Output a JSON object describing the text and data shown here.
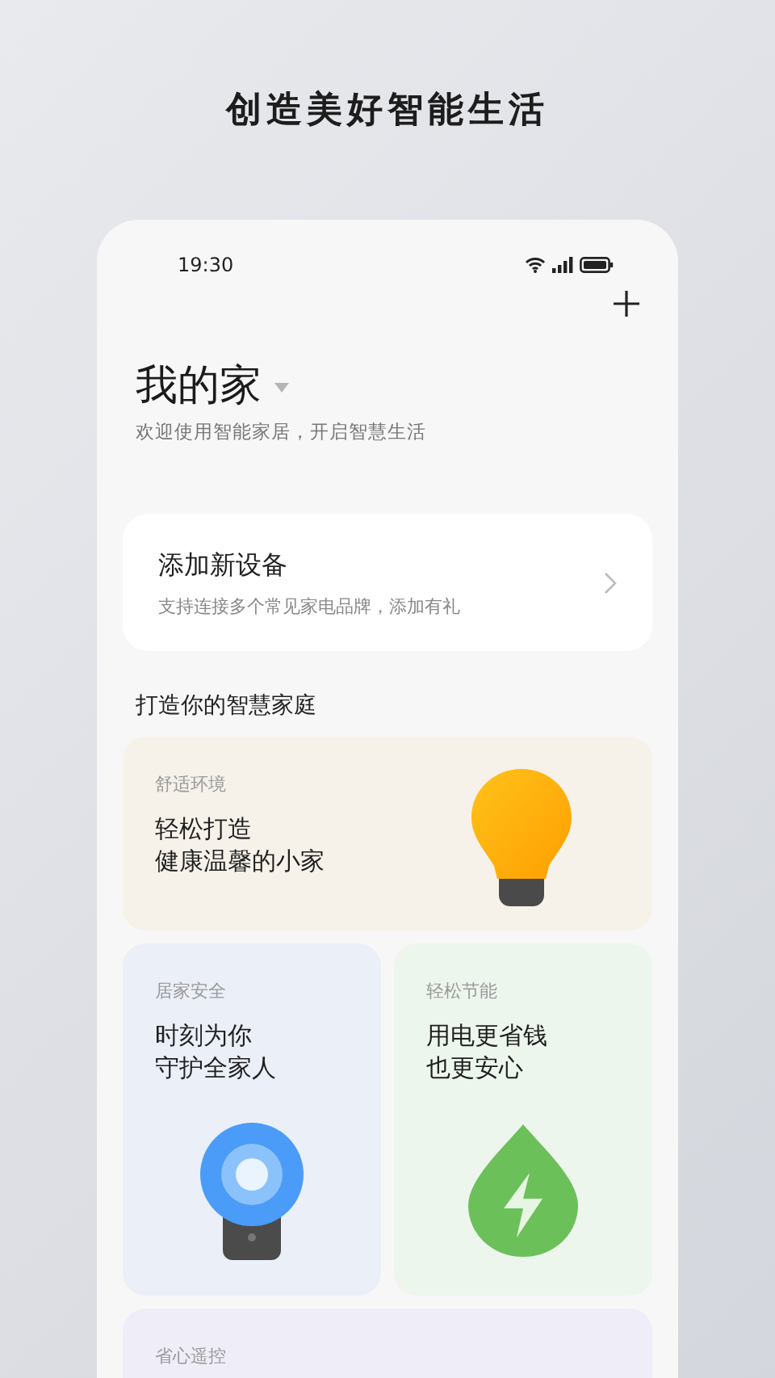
{
  "headline": "创造美好智能生活",
  "status_bar": {
    "time": "19:30"
  },
  "home": {
    "title": "我的家",
    "subtitle": "欢迎使用智能家居，开启智慧生活"
  },
  "add_device": {
    "title": "添加新设备",
    "subtitle": "支持连接多个常见家电品牌，添加有礼"
  },
  "section_title": "打造你的智慧家庭",
  "cards": [
    {
      "kind": "bulb",
      "full_width": true,
      "color": "#f6f2ea",
      "label": "舒适环境",
      "lines": [
        "轻松打造",
        "健康温馨的小家"
      ]
    },
    {
      "kind": "sensor",
      "full_width": false,
      "color": "#ebeff8",
      "label": "居家安全",
      "lines": [
        "时刻为你",
        "守护全家人"
      ]
    },
    {
      "kind": "drop",
      "full_width": false,
      "color": "#edf6ed",
      "label": "轻松节能",
      "lines": [
        "用电更省钱",
        "也更安心"
      ]
    },
    {
      "kind": "none",
      "full_width": true,
      "color": "#efedf8",
      "label": "省心遥控"
    }
  ]
}
